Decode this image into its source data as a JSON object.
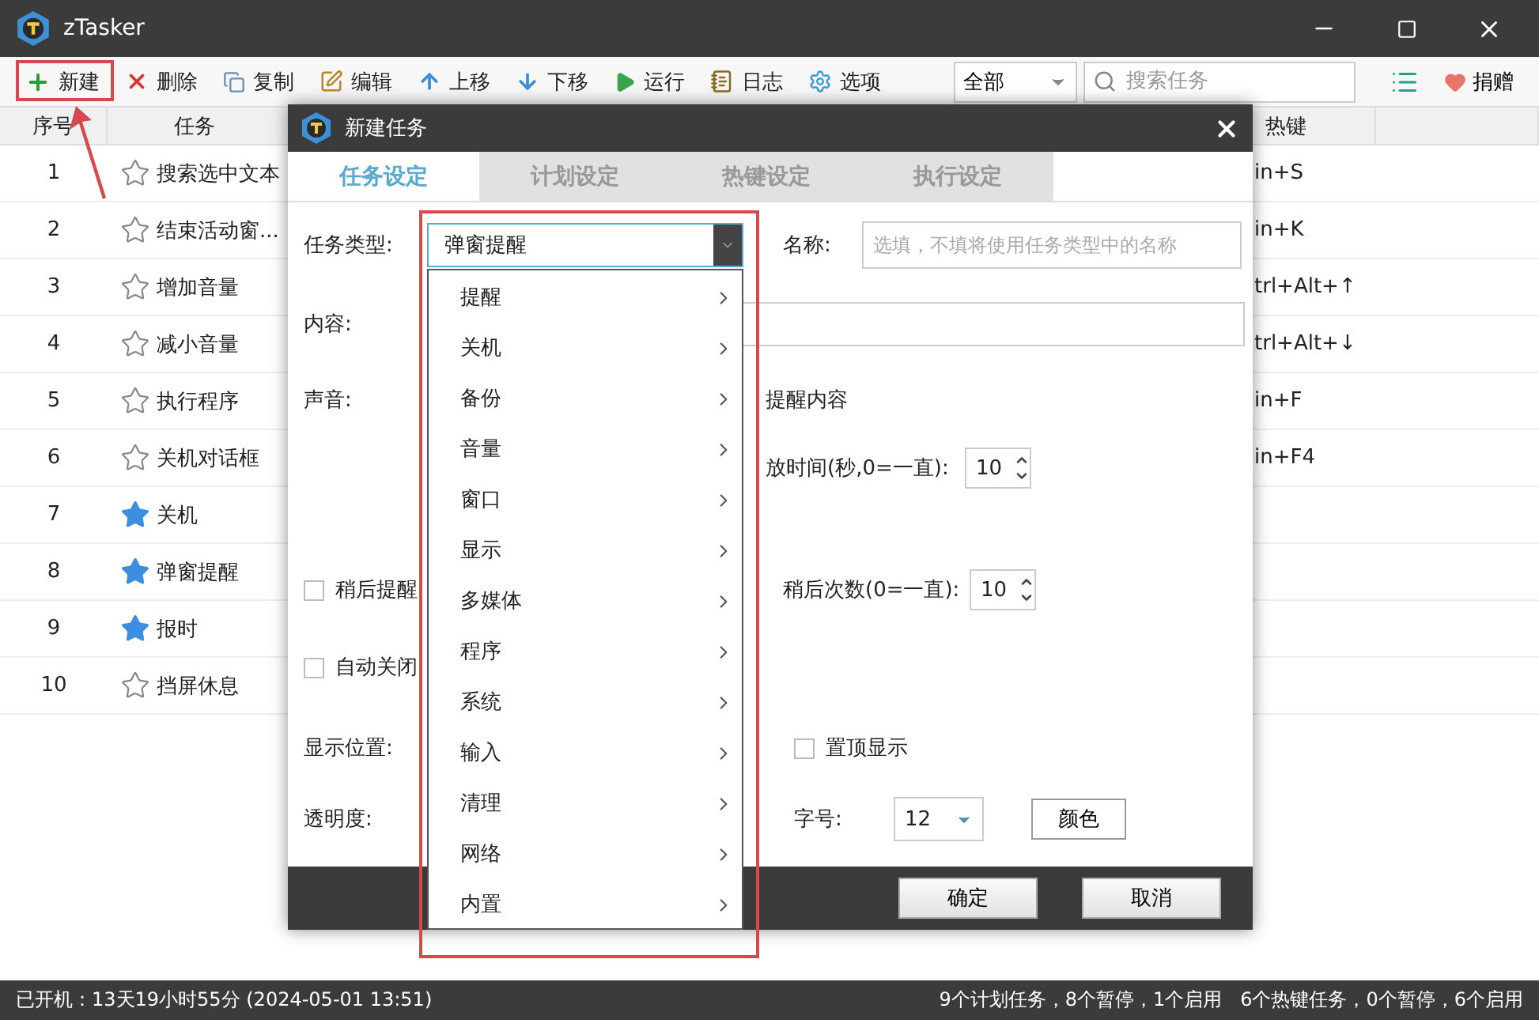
{
  "window": {
    "title": "zTasker"
  },
  "toolbar": {
    "buttons": [
      {
        "label": "新建"
      },
      {
        "label": "删除"
      },
      {
        "label": "复制"
      },
      {
        "label": "编辑"
      },
      {
        "label": "上移"
      },
      {
        "label": "下移"
      },
      {
        "label": "运行"
      },
      {
        "label": "日志"
      },
      {
        "label": "选项"
      }
    ],
    "filter": "全部",
    "search_placeholder": "搜索任务",
    "donate": "捐赠"
  },
  "table": {
    "columns": [
      "序号",
      "任务",
      "热键"
    ],
    "rows": [
      {
        "index": "1",
        "name": "搜索选中文本",
        "starred": false,
        "hotkey": "in+S"
      },
      {
        "index": "2",
        "name": "结束活动窗...",
        "starred": false,
        "hotkey": "in+K"
      },
      {
        "index": "3",
        "name": "增加音量",
        "starred": false,
        "hotkey": "trl+Alt+↑"
      },
      {
        "index": "4",
        "name": "减小音量",
        "starred": false,
        "hotkey": "trl+Alt+↓"
      },
      {
        "index": "5",
        "name": "执行程序",
        "starred": false,
        "hotkey": "in+F"
      },
      {
        "index": "6",
        "name": "关机对话框",
        "starred": false,
        "hotkey": "in+F4"
      },
      {
        "index": "7",
        "name": "关机",
        "starred": true
      },
      {
        "index": "8",
        "name": "弹窗提醒",
        "starred": true
      },
      {
        "index": "9",
        "name": "报时",
        "starred": true
      },
      {
        "index": "10",
        "name": "挡屏休息",
        "starred": false
      }
    ]
  },
  "status_bar": {
    "left": "已开机：13天19小时55分 (2024-05-01 13:51)",
    "right": "9个计划任务，8个暂停，1个启用   6个热键任务，0个暂停，6个启用"
  },
  "dialog": {
    "title": "新建任务",
    "tabs": [
      {
        "label": "任务设定",
        "selected": true
      },
      {
        "label": "计划设定",
        "selected": false
      },
      {
        "label": "热键设定",
        "selected": false
      },
      {
        "label": "执行设定",
        "selected": false
      }
    ],
    "type_label": "任务类型:",
    "type_value": "弹窗提醒",
    "name_label": "名称:",
    "name_placeholder": "选填，不填将使用任务类型中的名称",
    "content_label": "内容:",
    "sound_label": "声音:",
    "read_text": "提醒内容",
    "play_time_label": "放时间(秒,0=一直):",
    "play_time": "10",
    "snooze": {
      "label": "稍后提醒",
      "checked": false
    },
    "snooze_count_label": "稍后次数(0=一直):",
    "snooze_count": "10",
    "auto_close": {
      "label": "自动关闭",
      "checked": false
    },
    "position_label": "显示位置:",
    "topmost": {
      "label": "置顶显示",
      "checked": false
    },
    "opacity_label": "透明度:",
    "font_size_label": "字号:",
    "font_size": "12",
    "color_button": "颜色",
    "ok": "确定",
    "cancel": "取消",
    "type_menu": [
      "提醒",
      "关机",
      "备份",
      "音量",
      "窗口",
      "显示",
      "多媒体",
      "程序",
      "系统",
      "输入",
      "清理",
      "网络",
      "内置"
    ]
  }
}
